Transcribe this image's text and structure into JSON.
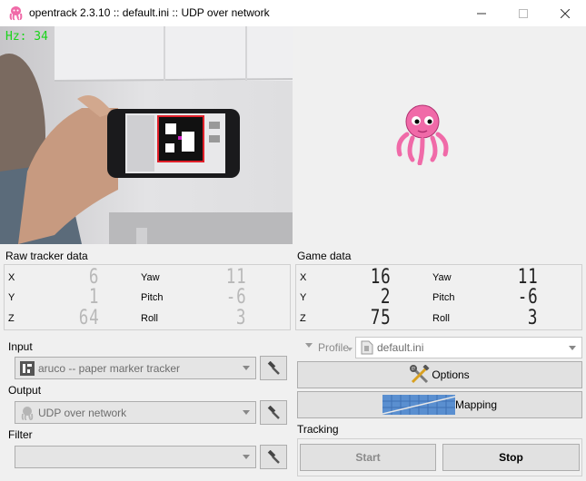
{
  "window": {
    "title": "opentrack 2.3.10 :: default.ini :: UDP over network",
    "minimize_icon": "minimize-icon",
    "maximize_icon": "maximize-icon",
    "close_icon": "close-icon"
  },
  "camera": {
    "hz_label": "Hz: 34"
  },
  "raw_tracker": {
    "title": "Raw tracker data",
    "rows": [
      {
        "label": "X",
        "value": "6",
        "rot_label": "Yaw",
        "rot_value": "11"
      },
      {
        "label": "Y",
        "value": "1",
        "rot_label": "Pitch",
        "rot_value": "-6"
      },
      {
        "label": "Z",
        "value": "64",
        "rot_label": "Roll",
        "rot_value": "3"
      }
    ]
  },
  "game_data": {
    "title": "Game data",
    "rows": [
      {
        "label": "X",
        "value": "16",
        "rot_label": "Yaw",
        "rot_value": "11"
      },
      {
        "label": "Y",
        "value": "2",
        "rot_label": "Pitch",
        "rot_value": "-6"
      },
      {
        "label": "Z",
        "value": "75",
        "rot_label": "Roll",
        "rot_value": "3"
      }
    ]
  },
  "input": {
    "title": "Input",
    "selected": "aruco -- paper marker tracker"
  },
  "output": {
    "title": "Output",
    "selected": "UDP over network"
  },
  "filter": {
    "title": "Filter",
    "selected": ""
  },
  "profile": {
    "label": "Profile",
    "selected": "default.ini"
  },
  "buttons": {
    "options": "Options",
    "mapping": "Mapping",
    "start": "Start",
    "stop": "Stop"
  },
  "tracking": {
    "title": "Tracking"
  },
  "colors": {
    "hz_text": "#19d419",
    "inactive_digits": "#b8b8b8",
    "active_digits": "#222222",
    "octopus": "#f06aa8"
  }
}
